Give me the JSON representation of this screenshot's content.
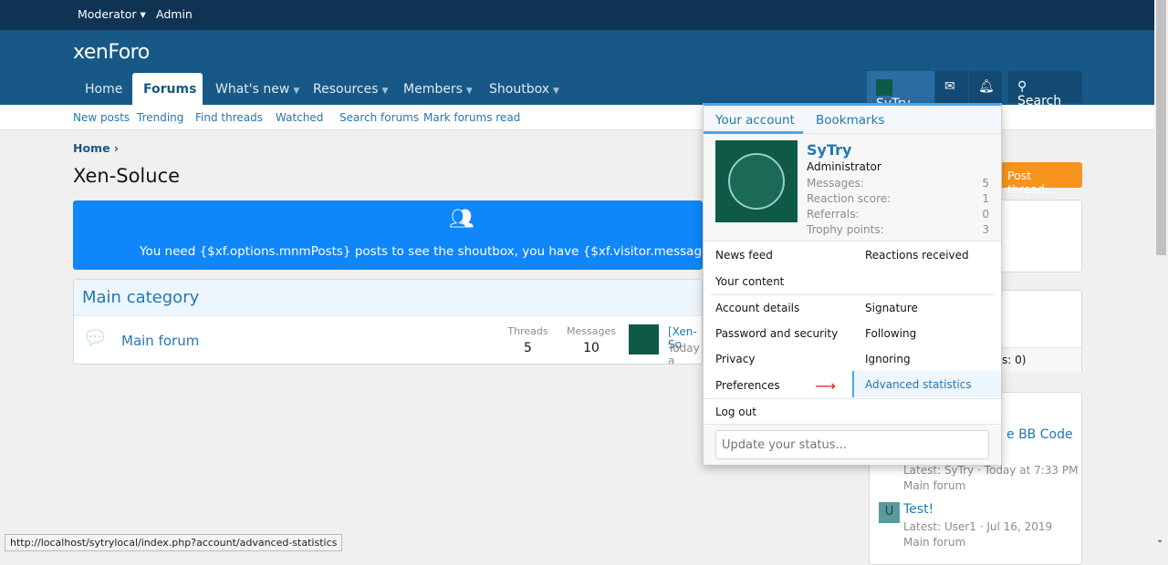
{
  "topbar": {
    "moderator": "Moderator",
    "admin": "Admin"
  },
  "header": {
    "logo": "xenForo",
    "nav": [
      "Home",
      "Forums",
      "What's new",
      "Resources",
      "Members",
      "Shoutbox"
    ],
    "user": "SyTry",
    "search": "Search"
  },
  "subnav": [
    "New posts",
    "Trending",
    "Find threads",
    "Watched",
    "Search forums",
    "Mark forums read"
  ],
  "breadcrumb": "Home",
  "page_title": "Xen-Soluce",
  "notice": "You need {$xf.options.mnmPosts} posts to see the shoutbox, you have {$xf.visitor.message_count|nu",
  "category": {
    "title": "Main category",
    "forum": "Main forum",
    "threads_label": "Threads",
    "threads": "5",
    "messages_label": "Messages",
    "messages": "10",
    "latest_title": "[Xen-So",
    "latest_time": "Today a"
  },
  "post_thread": "Post thread...",
  "sidebar": {
    "fragment_stats": "s: 0)",
    "fragment_thread": "e BB Code",
    "thread1_meta": "Latest: SyTry · Today at 7:33 PM",
    "thread1_forum": "Main forum",
    "thread2_title": "Test!",
    "thread2_avatar": "U",
    "thread2_meta": "Latest: User1 · Jul 16, 2019",
    "thread2_forum": "Main forum"
  },
  "account_menu": {
    "tabs": [
      "Your account",
      "Bookmarks"
    ],
    "username": "SyTry",
    "role": "Administrator",
    "stats": [
      {
        "label": "Messages:",
        "value": "5"
      },
      {
        "label": "Reaction score:",
        "value": "1"
      },
      {
        "label": "Referrals:",
        "value": "0"
      },
      {
        "label": "Trophy points:",
        "value": "3"
      }
    ],
    "links": {
      "news_feed": "News feed",
      "reactions": "Reactions received",
      "content": "Your content",
      "account": "Account details",
      "signature": "Signature",
      "password": "Password and security",
      "following": "Following",
      "privacy": "Privacy",
      "ignoring": "Ignoring",
      "preferences": "Preferences",
      "advanced": "Advanced statistics",
      "logout": "Log out"
    },
    "status_placeholder": "Update your status..."
  },
  "statusbar": "http://localhost/sytrylocal/index.php?account/advanced-statistics",
  "colors": {
    "header": "#185886",
    "accent": "#2577b1",
    "notice": "#0f86f9",
    "button": "#f7931e"
  }
}
